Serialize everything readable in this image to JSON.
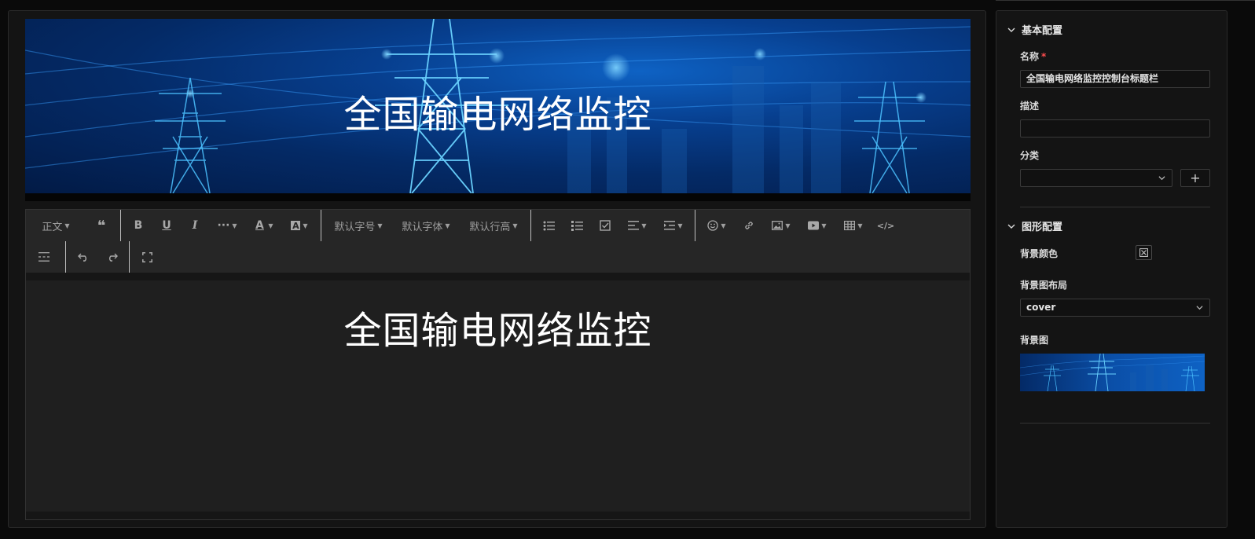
{
  "banner": {
    "title": "全国输电网络监控"
  },
  "toolbar": {
    "paragraph": "正文",
    "font_size": "默认字号",
    "font_family": "默认字体",
    "line_height": "默认行高"
  },
  "editor": {
    "content_title": "全国输电网络监控"
  },
  "config": {
    "basic_section": "基本配置",
    "name_label": "名称",
    "name_required": "*",
    "name_value": "全国输电网络监控控制台标题栏",
    "desc_label": "描述",
    "desc_value": "",
    "category_label": "分类",
    "category_value": "",
    "add_symbol": "+",
    "graphic_section": "图形配置",
    "bg_color_label": "背景颜色",
    "bg_layout_label": "背景图布局",
    "bg_layout_value": "cover",
    "bg_image_label": "背景图"
  },
  "colors": {
    "accent_blue": "#0e62c4",
    "panel_bg": "#141414",
    "required": "#ff4d4f"
  }
}
